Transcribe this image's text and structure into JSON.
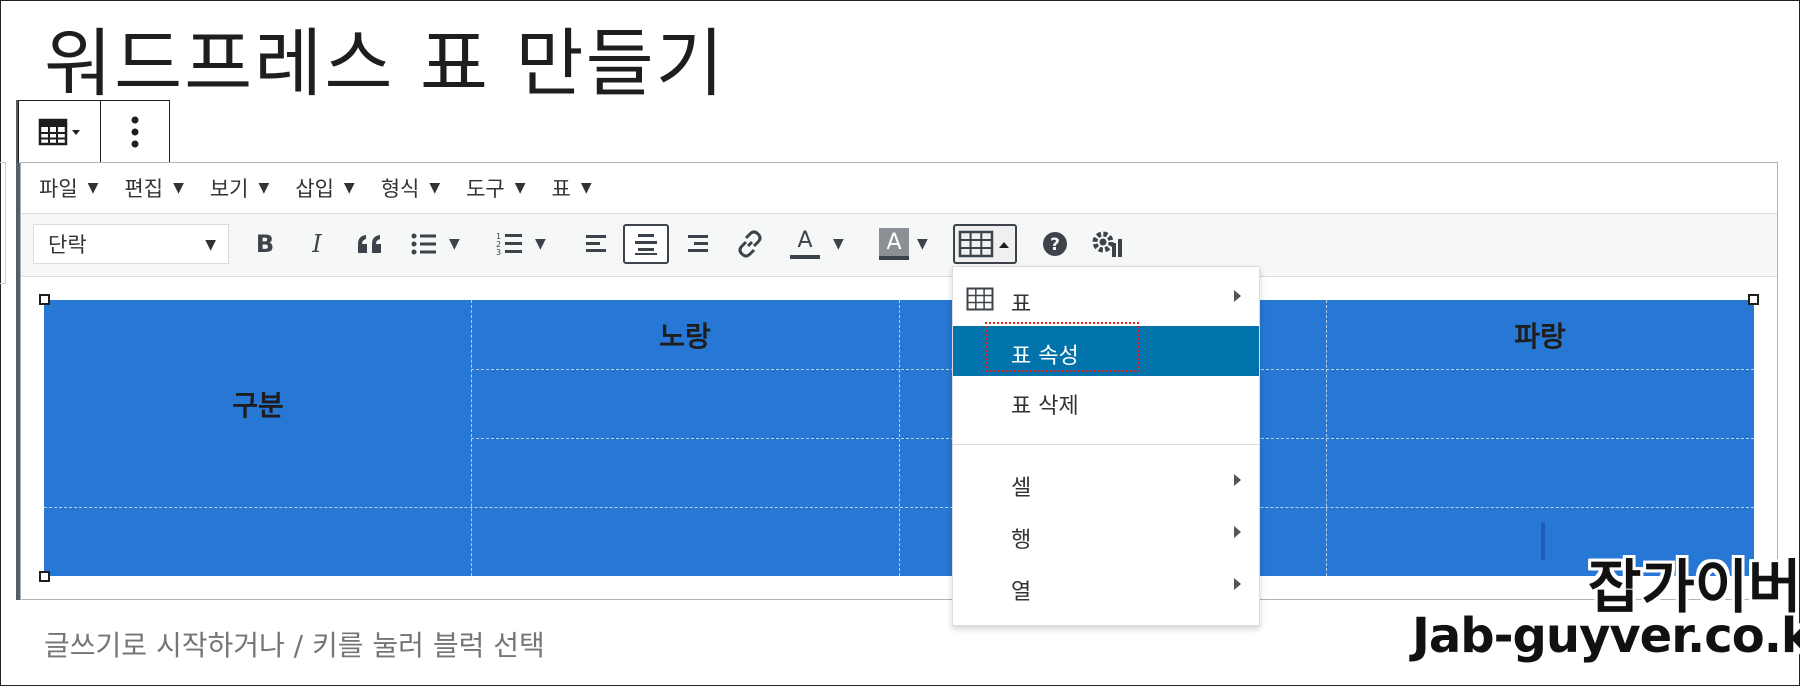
{
  "title": "워드프레스 표 만들기",
  "menubar": {
    "items": [
      {
        "label": "파일"
      },
      {
        "label": "편집"
      },
      {
        "label": "보기"
      },
      {
        "label": "삽입"
      },
      {
        "label": "형식"
      },
      {
        "label": "도구"
      },
      {
        "label": "표"
      }
    ]
  },
  "toolbar": {
    "format_select": "단락",
    "bold": "B",
    "italic": "I",
    "blockquote": "66",
    "text_color": "A",
    "bg_color": "A"
  },
  "table": {
    "header_left": "구분",
    "col2": "노랑",
    "col4": "파랑",
    "fill_color": "#2778d4"
  },
  "dropdown": {
    "items": [
      {
        "label": "표"
      },
      {
        "label": "표 속성"
      },
      {
        "label": "표 삭제"
      },
      {
        "label": "셀"
      },
      {
        "label": "행"
      },
      {
        "label": "열"
      }
    ],
    "highlight_color": "#0073aa"
  },
  "placeholder": "글쓰기로 시작하거나 / 키를 눌러 블럭 선택",
  "watermark": {
    "name": "잡가이버",
    "url": "Jab-guyver.co.kr"
  }
}
